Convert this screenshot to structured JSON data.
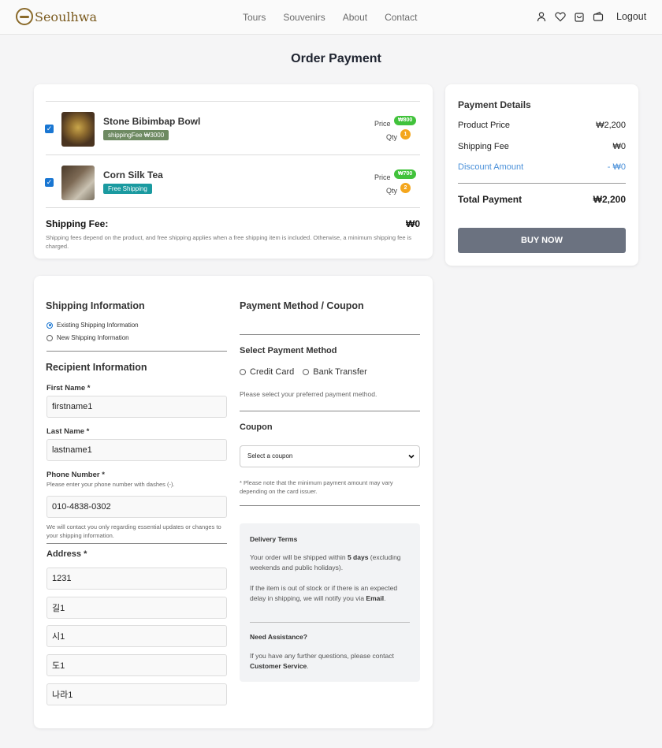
{
  "brand": {
    "name": "Seoulhwa"
  },
  "nav": {
    "links": [
      "Tours",
      "Souvenirs",
      "About",
      "Contact"
    ],
    "icons": [
      "user-icon",
      "heart-icon",
      "cart-icon",
      "wallet-icon"
    ],
    "logout": "Logout"
  },
  "page": {
    "title": "Order Payment"
  },
  "cart": {
    "items": [
      {
        "name": "Stone Bibimbap Bowl",
        "tag": "shippingFee ₩3000",
        "tag_color": "#6e8a62",
        "price_label": "Price",
        "price": "₩800",
        "qty_label": "Qty",
        "qty": "1",
        "checked": true
      },
      {
        "name": "Corn Silk Tea",
        "tag": "Free Shipping",
        "tag_color": "#1a9aa0",
        "price_label": "Price",
        "price": "₩700",
        "qty_label": "Qty",
        "qty": "2",
        "checked": true
      }
    ],
    "shipping_fee_label": "Shipping Fee:",
    "shipping_fee_value": "₩0",
    "shipping_note": "Shipping fees depend on the product, and free shipping applies when a free shipping item is included. Otherwise, a minimum shipping fee is charged."
  },
  "payment_details": {
    "title": "Payment Details",
    "product_price_label": "Product Price",
    "product_price": "₩2,200",
    "shipping_fee_label": "Shipping Fee",
    "shipping_fee": "₩0",
    "discount_label": "Discount Amount",
    "discount": "- ₩0",
    "total_label": "Total Payment",
    "total": "₩2,200",
    "buy_button": "BUY NOW"
  },
  "shipping_info": {
    "title": "Shipping Information",
    "options": [
      "Existing Shipping Information",
      "New Shipping Information"
    ],
    "selected_option": 0
  },
  "recipient": {
    "title": "Recipient Information",
    "first_name_label": "First Name *",
    "first_name": "firstname1",
    "last_name_label": "Last Name *",
    "last_name": "lastname1",
    "phone_label": "Phone Number *",
    "phone_hint": "Please enter your phone number with dashes (-).",
    "phone": "010-4838-0302",
    "contact_note": "We will contact you only regarding essential updates or changes to your shipping information.",
    "address_label": "Address *",
    "address_lines": [
      "1231",
      "길1",
      "시1",
      "도1",
      "나라1"
    ]
  },
  "payment_method": {
    "title": "Payment Method / Coupon",
    "select_title": "Select Payment Method",
    "methods": [
      "Credit Card",
      "Bank Transfer"
    ],
    "hint": "Please select your preferred payment method.",
    "coupon_title": "Coupon",
    "coupon_value": "Select a coupon",
    "coupon_note": "* Please note that the minimum payment amount may vary depending on the card issuer."
  },
  "terms": {
    "delivery_title": "Delivery Terms",
    "delivery_p1_pre": "Your order will be shipped within ",
    "delivery_p1_bold": "5 days",
    "delivery_p1_post": " (excluding weekends and public holidays).",
    "delivery_p2_pre": "If the item is out of stock or if there is an expected delay in shipping, we will notify you via ",
    "delivery_p2_bold": "Email",
    "delivery_p2_post": ".",
    "assist_title": "Need Assistance?",
    "assist_pre": "If you have any further questions, please contact ",
    "assist_bold": "Customer Service",
    "assist_post": "."
  }
}
